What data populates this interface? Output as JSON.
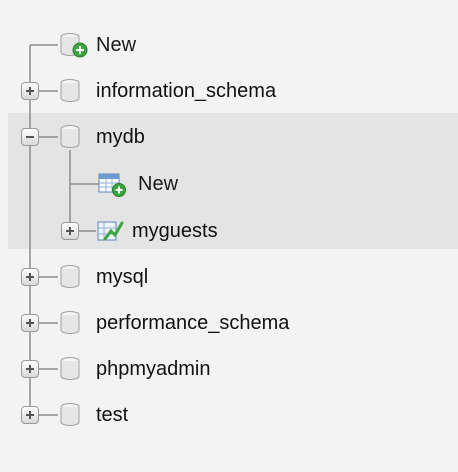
{
  "tree": {
    "items": [
      {
        "label": "New",
        "kind": "new-database",
        "expander": "none"
      },
      {
        "label": "information_schema",
        "kind": "database",
        "expander": "plus"
      },
      {
        "label": "mydb",
        "kind": "database",
        "expander": "minus",
        "selected": true,
        "children": [
          {
            "label": "New",
            "kind": "new-table",
            "expander": "none"
          },
          {
            "label": "myguests",
            "kind": "table",
            "expander": "plus"
          }
        ]
      },
      {
        "label": "mysql",
        "kind": "database",
        "expander": "plus"
      },
      {
        "label": "performance_schema",
        "kind": "database",
        "expander": "plus"
      },
      {
        "label": "phpmyadmin",
        "kind": "database",
        "expander": "plus"
      },
      {
        "label": "test",
        "kind": "database",
        "expander": "plus"
      }
    ]
  },
  "colors": {
    "background": "#f3f3f3",
    "selected_background": "#e4e4e4",
    "tree_line": "#8c8c8c",
    "new_badge": "#3aa640"
  }
}
